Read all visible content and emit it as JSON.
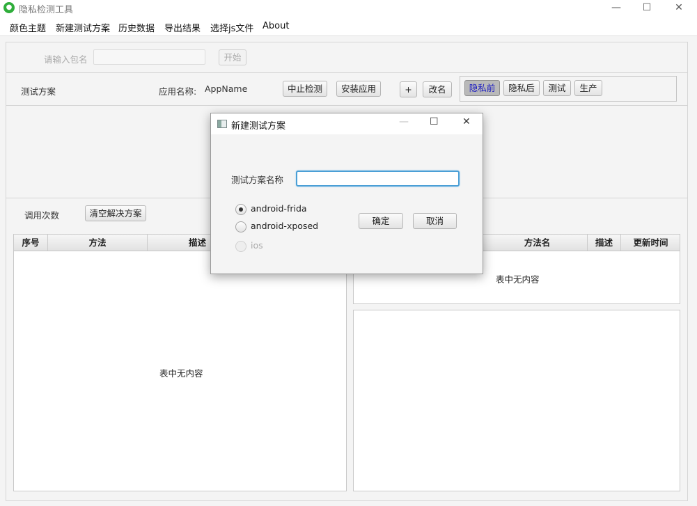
{
  "window": {
    "title": "隐私检测工具",
    "icon": "app-person-icon",
    "minimize_glyph": "—",
    "maximize_glyph": "☐",
    "close_glyph": "✕"
  },
  "menu": {
    "items": [
      "颜色主题",
      "新建测试方案",
      "历史数据",
      "导出结果",
      "选择js文件",
      "About"
    ]
  },
  "package_row": {
    "label": "请输入包名",
    "input_value": "",
    "start_button": "开始"
  },
  "toolbar": {
    "scheme_label": "测试方案",
    "app_name_label": "应用名称:",
    "app_name_value": "AppName",
    "stop_button": "中止检测",
    "install_button": "安装应用",
    "add_button": "+",
    "rename_button": "改名",
    "phase_buttons": [
      "隐私前",
      "隐私后",
      "测试",
      "生产"
    ],
    "active_phase": "隐私前"
  },
  "calls_row": {
    "label": "调用次数",
    "clear_button": "清空解决方案"
  },
  "left_table": {
    "columns": [
      "序号",
      "方法",
      "描述"
    ],
    "empty_text": "表中无内容"
  },
  "right_table": {
    "columns": [
      "方法名",
      "描述",
      "更新时间"
    ],
    "empty_text": "表中无内容"
  },
  "dialog": {
    "title": "新建测试方案",
    "name_label": "测试方案名称",
    "name_value": "",
    "options": [
      {
        "label": "android-frida",
        "checked": true,
        "enabled": true
      },
      {
        "label": "android-xposed",
        "checked": false,
        "enabled": true
      },
      {
        "label": "ios",
        "checked": false,
        "enabled": false
      }
    ],
    "ok_button": "确定",
    "cancel_button": "取消"
  },
  "colors": {
    "accent": "#4b9fd6",
    "active_tab_text": "#2020c0",
    "app_icon": "#2fae3b"
  }
}
